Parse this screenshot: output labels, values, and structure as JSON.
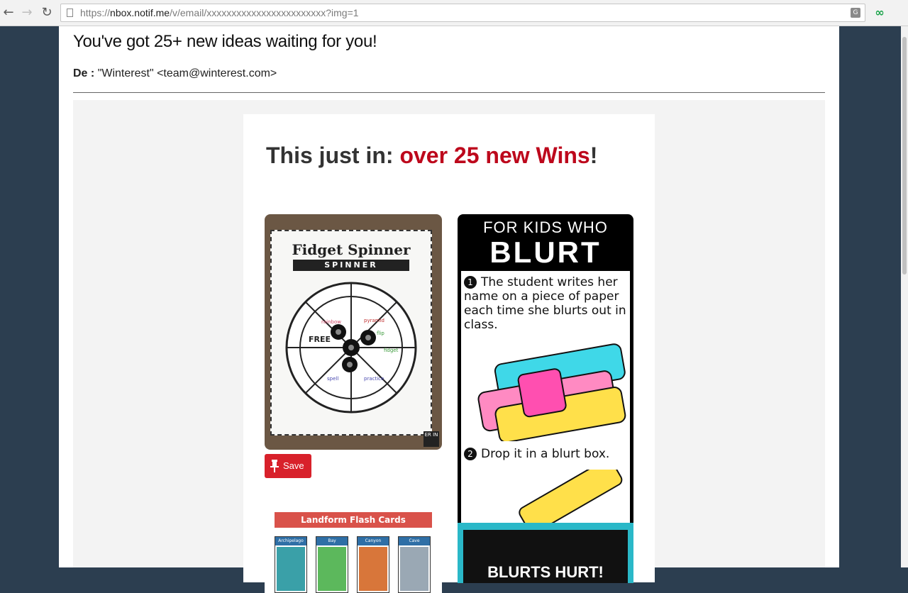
{
  "browser": {
    "url_scheme": "https://",
    "url_host": "nbox.notif.me",
    "url_path": "/v/email/xxxxxxxxxxxxxxxxxxxxxxxx?img=1",
    "back_icon": "back-arrow-icon",
    "forward_icon": "forward-arrow-icon",
    "reload_icon": "reload-icon",
    "translate_icon": "translate-icon",
    "extension_icon": "infinity-extension-icon"
  },
  "email": {
    "subject": "You've got 25+ new ideas waiting for you!",
    "from_label": "De :",
    "from_value": "\"Winterest\" <team@winterest.com>"
  },
  "content": {
    "headline_prefix": "This just in: ",
    "headline_highlight": "over 25 new Wins",
    "headline_suffix": "!",
    "accent_color": "#bd081c",
    "pins": [
      {
        "title": "Fidget Spinner",
        "band": "SPINNER",
        "center_word": "FREE",
        "badge": "ER IN"
      },
      {
        "line1": "FOR KIDS WHO",
        "line2": "BLURT",
        "step1_num": "1",
        "step1": "The student writes her name on a piece of paper each time she blurts out in class.",
        "step2_num": "2",
        "step2": "Drop it in a blurt box.",
        "box_text": "BLURTS HURT!"
      },
      {
        "title": "Landform Flash Cards",
        "cards": [
          "Archipelago",
          "Bay",
          "Canyon",
          "Cave"
        ]
      }
    ],
    "save_label": "Save"
  }
}
